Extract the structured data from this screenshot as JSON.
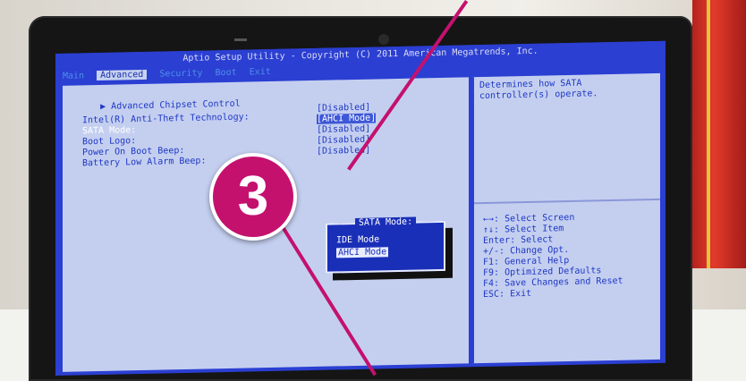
{
  "bios": {
    "title": "Aptio Setup Utility - Copyright (C) 2011 American Megatrends, Inc.",
    "tabs": [
      "Main",
      "Advanced",
      "Security",
      "Boot",
      "Exit"
    ],
    "active_tab": "Advanced",
    "menu_item": "Advanced Chipset Control",
    "settings": [
      {
        "label": "Intel(R) Anti-Theft Technology:",
        "value": "[Disabled]"
      },
      {
        "label": "SATA Mode:",
        "value": "[AHCI Mode]"
      },
      {
        "label": "Boot Logo:",
        "value": "[Disabled]"
      },
      {
        "label": "Power On Boot Beep:",
        "value": "[Disabled]"
      },
      {
        "label": "Battery Low Alarm Beep:",
        "value": "[Disabled]"
      }
    ],
    "help_text_1": "Determines how SATA",
    "help_text_2": "controller(s) operate.",
    "keys": [
      "←→: Select Screen",
      "↑↓: Select Item",
      "Enter: Select",
      "+/-: Change Opt.",
      "F1: General Help",
      "F9: Optimized Defaults",
      "F4: Save Changes and Reset",
      "ESC: Exit"
    ],
    "popup": {
      "title": "SATA Mode:",
      "options": [
        "IDE Mode",
        "AHCI Mode"
      ],
      "selected": "AHCI Mode"
    }
  },
  "callout": {
    "number": "3",
    "color": "#c4116e"
  }
}
